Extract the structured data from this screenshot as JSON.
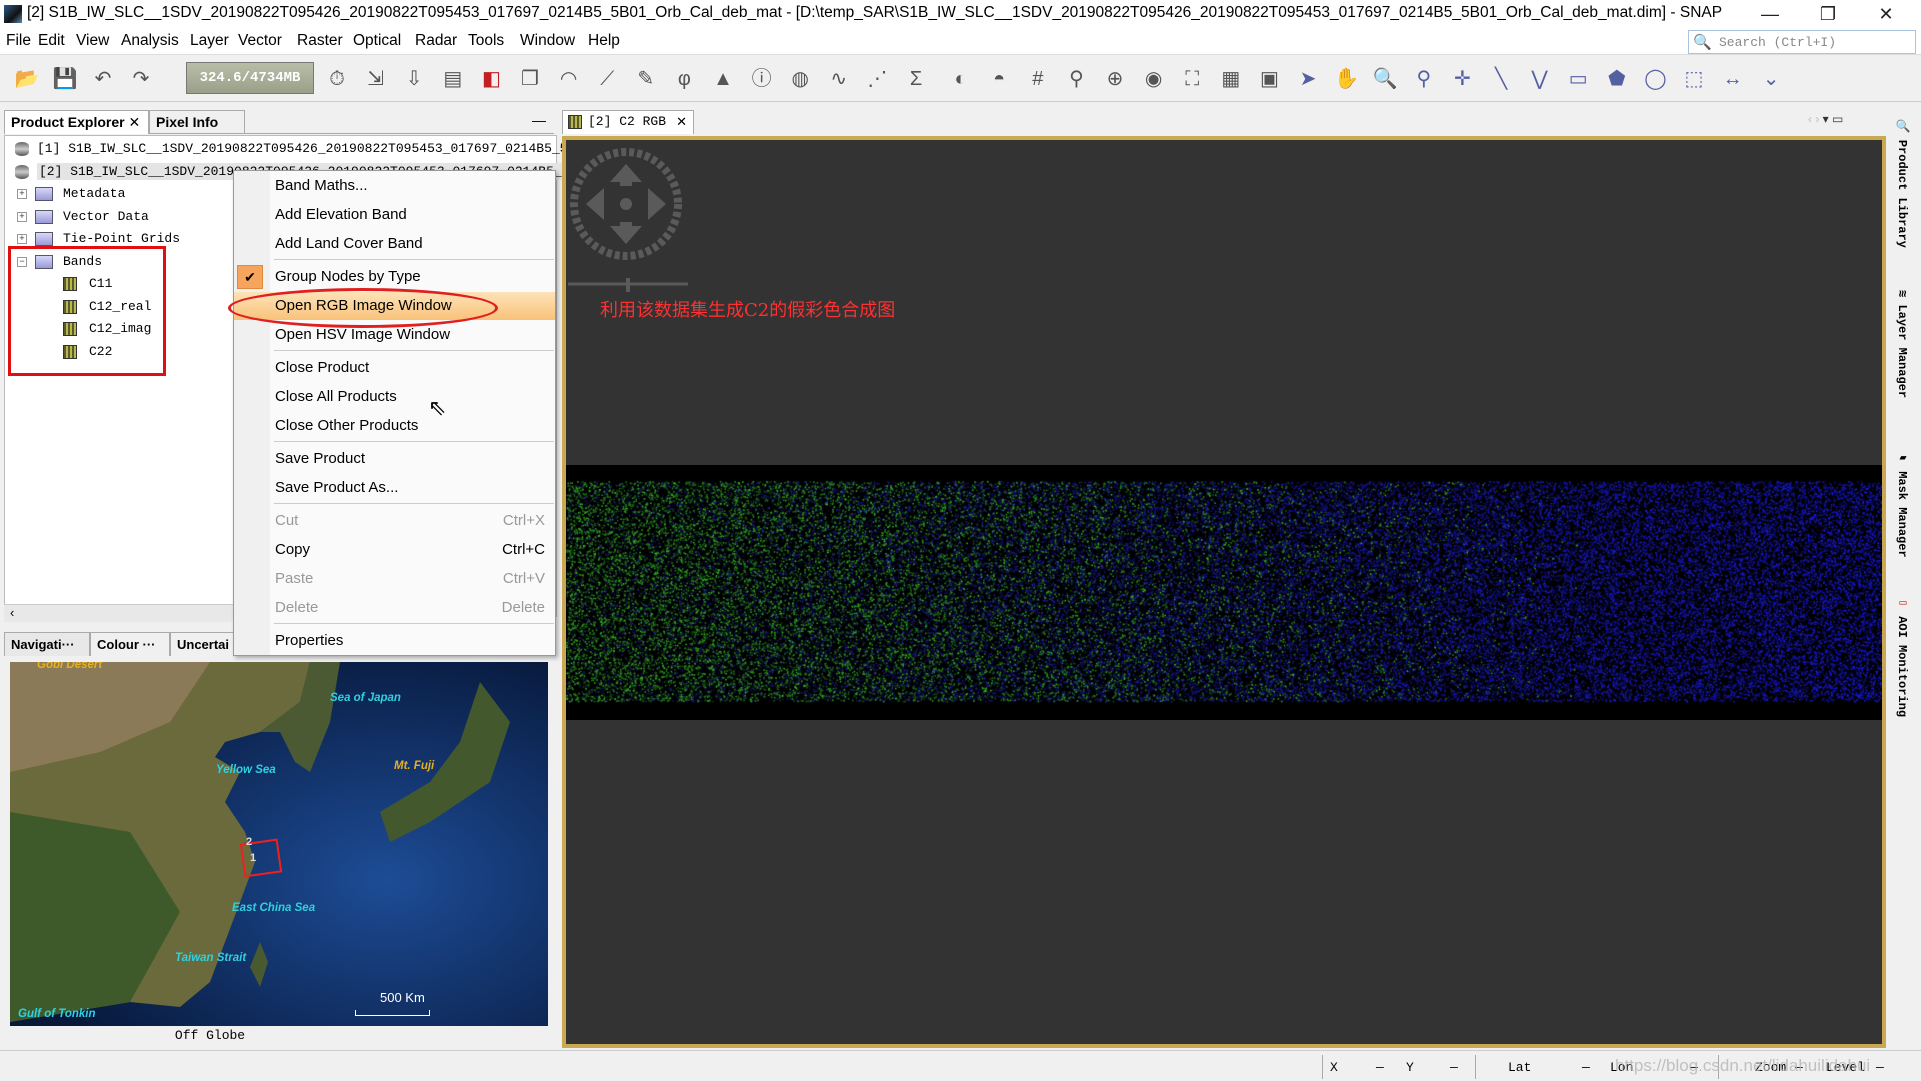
{
  "window": {
    "title": "[2] S1B_IW_SLC__1SDV_20190822T095426_20190822T095453_017697_0214B5_5B01_Orb_Cal_deb_mat - [D:\\temp_SAR\\S1B_IW_SLC__1SDV_20190822T095426_20190822T095453_017697_0214B5_5B01_Orb_Cal_deb_mat.dim] - SNAP",
    "minimize": "—",
    "restore": "❐",
    "close": "✕"
  },
  "menu": [
    "File",
    "Edit",
    "View",
    "Analysis",
    "Layer",
    "Vector",
    "Raster",
    "Optical",
    "Radar",
    "Tools",
    "Window",
    "Help"
  ],
  "search": {
    "placeholder": "Search (Ctrl+I)"
  },
  "toolbar": {
    "memory": "324.6/4734MB",
    "icons": [
      "open-product-icon",
      "save-product-icon",
      "undo-icon",
      "redo-icon",
      "gc-icon",
      "import-icon",
      "export-icon",
      "product-icon",
      "rgb-icon",
      "tile-icon",
      "wave-icon",
      "graph-icon",
      "edit-icon",
      "spectrum-icon",
      "histogram-icon",
      "info-icon",
      "stats-icon",
      "profile-icon",
      "scatter-icon",
      "sum-icon",
      "mask-icon",
      "cursor-sync-icon",
      "grid-icon",
      "pin-icon",
      "gcp-icon",
      "range-icon",
      "graph-builder-icon",
      "batch-icon",
      "aoi-icon",
      "select-icon",
      "pan-icon",
      "zoom-icon",
      "pin-add-icon",
      "gcp-add-icon",
      "line-icon",
      "polyline-icon",
      "rect-icon",
      "polygon-icon",
      "ellipse-icon",
      "shape-icon",
      "measure-icon",
      "more-icon"
    ],
    "glyphs": [
      "📂",
      "💾",
      "↶",
      "↷",
      "⏱",
      "⇲",
      "⇩",
      "▤",
      "◧",
      "❐",
      "◠",
      "⟋",
      "✎",
      "φ",
      "▲",
      "ⓘ",
      "◍",
      "∿",
      "⋰",
      "Σ",
      "◐",
      "◓",
      "#",
      "⚲",
      "⊕",
      "◉",
      "⛶",
      "▦",
      "▣",
      "➤",
      "✋",
      "🔍",
      "⚲",
      "✛",
      "╲",
      "⋁",
      "▭",
      "⬟",
      "◯",
      "⬚",
      "↔",
      "⌄"
    ]
  },
  "left_panel": {
    "tabs": [
      "Product Explorer",
      "Pixel Info"
    ],
    "close": "✕",
    "minimize": "—",
    "products": [
      "[1] S1B_IW_SLC__1SDV_20190822T095426_20190822T095453_017697_0214B5_5B01",
      "[2] S1B_IW_SLC__1SDV_20190822T095426_20190822T095453_017697_0214B5_5B01_Orb_Cal_deb_mat"
    ],
    "nodes": [
      "Metadata",
      "Vector Data",
      "Tie-Point Grids",
      "Bands"
    ],
    "bands": [
      "C11",
      "C12_real",
      "C12_imag",
      "C22"
    ],
    "bottom_tabs": [
      "Navigati···",
      "Colour ···",
      "Uncertai"
    ],
    "map_labels": [
      "Gobi Desert",
      "Sea of Japan",
      "Yellow Sea",
      "Mt. Fuji",
      "East China Sea",
      "Taiwan Strait",
      "Gulf of Tonkin",
      "500 Km",
      "2",
      "1"
    ],
    "off_globe": "Off Globe"
  },
  "context_menu": {
    "items": [
      {
        "label": "Band Maths..."
      },
      {
        "label": "Add Elevation Band"
      },
      {
        "label": "Add Land Cover Band"
      },
      {
        "label": "Group Nodes by Type",
        "checked": true
      },
      {
        "label": "Open RGB Image Window",
        "highlighted": true
      },
      {
        "label": "Open HSV Image Window"
      },
      {
        "label": "Close Product"
      },
      {
        "label": "Close All Products"
      },
      {
        "label": "Close Other Products"
      },
      {
        "label": "Save Product"
      },
      {
        "label": "Save Product As..."
      },
      {
        "label": "Cut",
        "shortcut": "Ctrl+X",
        "disabled": true
      },
      {
        "label": "Copy",
        "shortcut": "Ctrl+C"
      },
      {
        "label": "Paste",
        "shortcut": "Ctrl+V",
        "disabled": true
      },
      {
        "label": "Delete",
        "shortcut": "Delete",
        "disabled": true
      },
      {
        "label": "Properties"
      }
    ]
  },
  "image_view": {
    "tab": "[2] C2 RGB",
    "annotation": "利用该数据集生成C2的假彩色合成图"
  },
  "right_sidebar": [
    "Product Library",
    "Layer Manager",
    "Mask Manager",
    "AOI Monitoring"
  ],
  "status": {
    "x": "X",
    "y": "Y",
    "lat": "Lat",
    "lon": "Lon",
    "zoom": "Zoom",
    "level": "Level",
    "dash": "—",
    "watermark": "https://blog.csdn.net/lidahuilidahui"
  },
  "colors": {
    "accent_highlight": "#f9c27a",
    "annotation_red": "#e02020",
    "view_border": "#c8a850"
  }
}
